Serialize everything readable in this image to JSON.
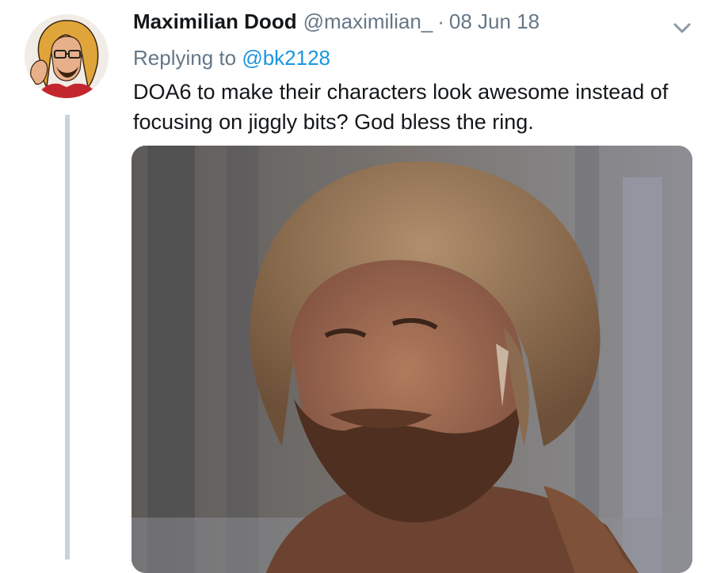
{
  "tweet": {
    "author_name": "Maximilian Dood",
    "handle": "@maximilian_",
    "separator": "·",
    "date": "08 Jun 18",
    "replying_prefix": "Replying to",
    "replying_to": "@bk2128",
    "text": "DOA6 to make their characters look awesome instead of focusing on jiggly bits? God bless the ring.",
    "menu_icon": "chevron-down-icon"
  },
  "colors": {
    "text": "#14171a",
    "secondary": "#657786",
    "link": "#1b95e0",
    "thread_line": "#c8d3dc"
  }
}
